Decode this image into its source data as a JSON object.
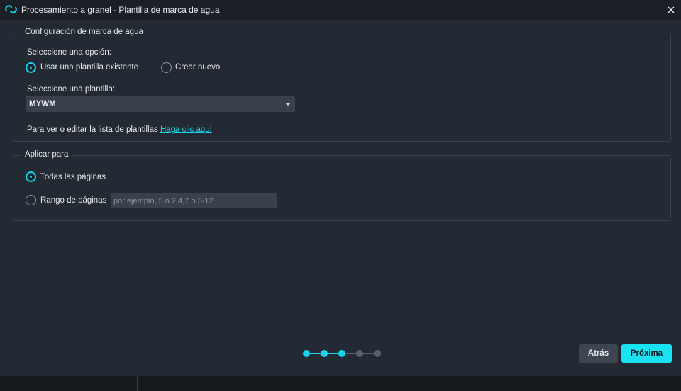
{
  "window": {
    "title": "Procesamiento a granel - Plantilla de marca de agua",
    "app_icon": "app-logo-icon",
    "close_icon": "close-icon"
  },
  "watermark_config": {
    "legend": "Configuración de marca de agua",
    "option_label": "Seleccione una opción:",
    "options": [
      {
        "label": "Usar una plantilla existente",
        "selected": true
      },
      {
        "label": "Crear nuevo",
        "selected": false
      }
    ],
    "template_label": "Seleccione una plantilla:",
    "template_value": "MYWM",
    "edit_text": "Para ver o editar la lista de plantillas",
    "edit_link": "Haga clic aquí"
  },
  "apply_to": {
    "legend": "Aplicar para",
    "all_pages": {
      "label": "Todas las páginas",
      "selected": true
    },
    "page_range": {
      "label": "Rango de páginas",
      "selected": false,
      "placeholder": "por ejemplo, 5 o 2,4,7 o 5-12",
      "value": ""
    }
  },
  "wizard": {
    "total_steps": 5,
    "current_step": 3
  },
  "buttons": {
    "back": "Atrás",
    "next": "Próxima"
  },
  "colors": {
    "accent": "#19d3ea",
    "background": "#242a33",
    "titlebar": "#1b1f26",
    "inactive_step": "#5b626d"
  }
}
